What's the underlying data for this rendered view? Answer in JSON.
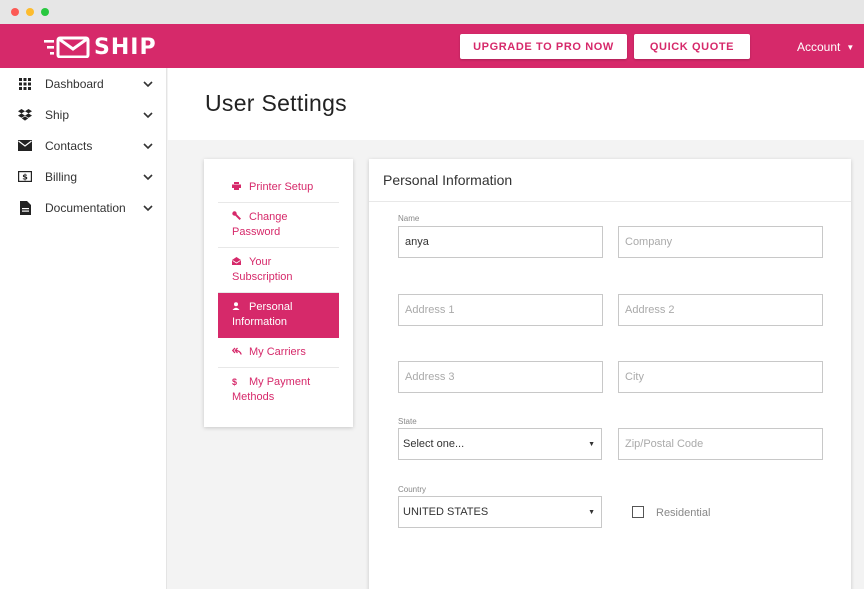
{
  "brand": {
    "name": "SHIP",
    "color": "#d6296a"
  },
  "header": {
    "upgrade_label": "UPGRADE TO PRO NOW",
    "quote_label": "QUICK QUOTE",
    "account_label": "Account"
  },
  "sidebar": {
    "items": [
      {
        "label": "Dashboard",
        "icon": "grid-icon"
      },
      {
        "label": "Ship",
        "icon": "dropbox-icon"
      },
      {
        "label": "Contacts",
        "icon": "envelope-icon"
      },
      {
        "label": "Billing",
        "icon": "dollar-bill-icon"
      },
      {
        "label": "Documentation",
        "icon": "document-icon"
      }
    ]
  },
  "page": {
    "title": "User Settings"
  },
  "settings_menu": {
    "items": [
      {
        "label": "Printer Setup",
        "icon": "printer-icon"
      },
      {
        "label": "Change Password",
        "icon": "wrench-icon"
      },
      {
        "label": "Your Subscription",
        "icon": "envelope-open-icon"
      },
      {
        "label": "Personal Information",
        "icon": "user-icon",
        "active": true
      },
      {
        "label": "My Carriers",
        "icon": "reply-all-icon"
      },
      {
        "label": "My Payment Methods",
        "icon": "dollar-icon"
      }
    ]
  },
  "form": {
    "title": "Personal Information",
    "name": {
      "label": "Name",
      "value": "anya"
    },
    "company": {
      "placeholder": "Company"
    },
    "address1": {
      "placeholder": "Address 1"
    },
    "address2": {
      "placeholder": "Address 2"
    },
    "address3": {
      "placeholder": "Address 3"
    },
    "city": {
      "placeholder": "City"
    },
    "state": {
      "label": "State",
      "selected": "Select one..."
    },
    "zip": {
      "placeholder": "Zip/Postal Code"
    },
    "country": {
      "label": "Country",
      "selected": "UNITED STATES"
    },
    "residential": {
      "label": "Residential",
      "checked": false
    }
  }
}
